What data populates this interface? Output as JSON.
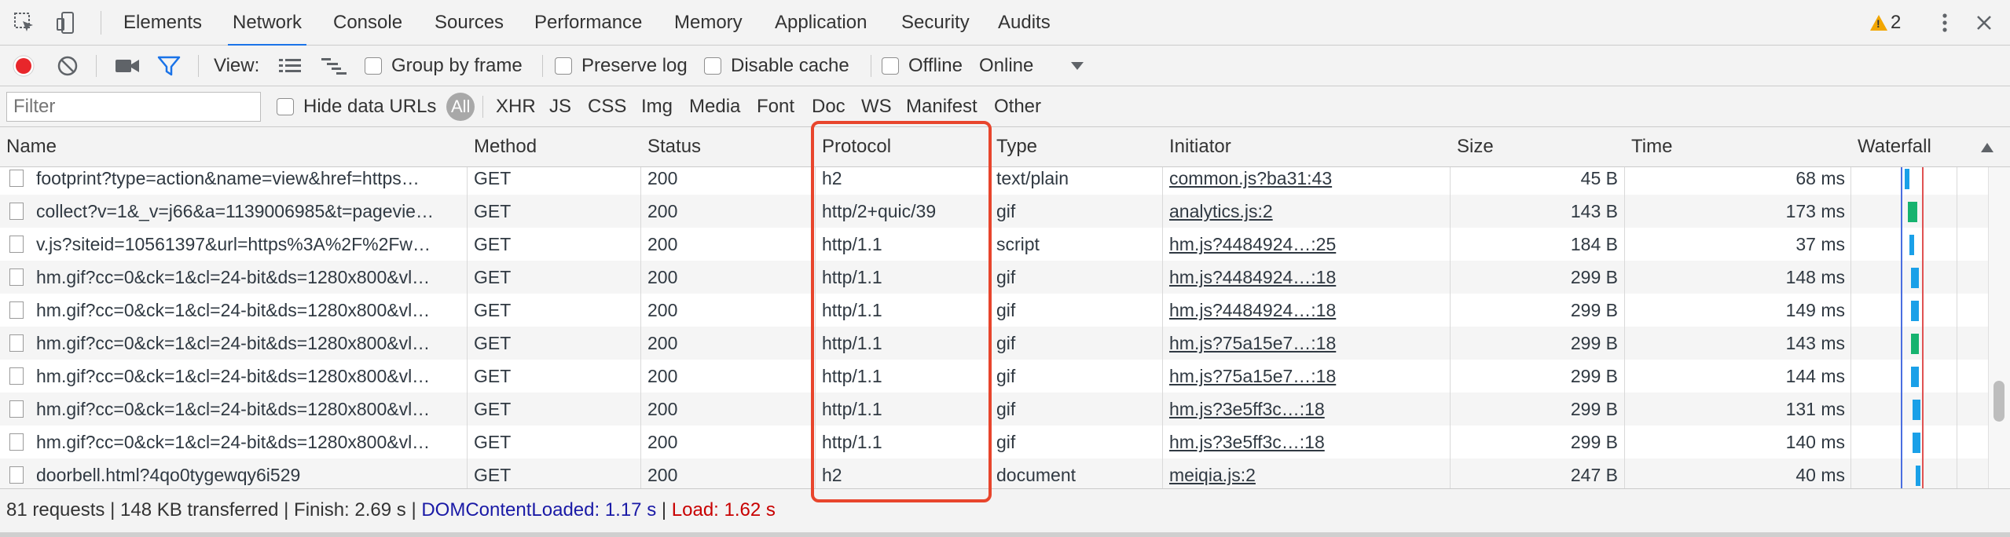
{
  "tabs": [
    "Elements",
    "Network",
    "Console",
    "Sources",
    "Performance",
    "Memory",
    "Application",
    "Security",
    "Audits"
  ],
  "active_tab": "Network",
  "warning_count": "2",
  "toolbar": {
    "view_label": "View:",
    "group_by_frame": "Group by frame",
    "preserve_log": "Preserve log",
    "disable_cache": "Disable cache",
    "offline": "Offline",
    "throttle": "Online"
  },
  "filter": {
    "placeholder": "Filter",
    "hide_data_urls": "Hide data URLs",
    "types": [
      "All",
      "XHR",
      "JS",
      "CSS",
      "Img",
      "Media",
      "Font",
      "Doc",
      "WS",
      "Manifest",
      "Other"
    ]
  },
  "columns": [
    "Name",
    "Method",
    "Status",
    "Protocol",
    "Type",
    "Initiator",
    "Size",
    "Time",
    "Waterfall"
  ],
  "rows": [
    {
      "name": "footprint?type=action&name=view&href=https…",
      "method": "GET",
      "status": "200",
      "protocol": "h2",
      "type": "text/plain",
      "initiator": "common.js?ba31:43",
      "size": "45 B",
      "time": "68 ms"
    },
    {
      "name": "collect?v=1&_v=j66&a=1139006985&t=pagevie…",
      "method": "GET",
      "status": "200",
      "protocol": "http/2+quic/39",
      "type": "gif",
      "initiator": "analytics.js:2",
      "size": "143 B",
      "time": "173 ms"
    },
    {
      "name": "v.js?siteid=10561397&url=https%3A%2F%2Fw…",
      "method": "GET",
      "status": "200",
      "protocol": "http/1.1",
      "type": "script",
      "initiator": "hm.js?4484924…:25",
      "size": "184 B",
      "time": "37 ms"
    },
    {
      "name": "hm.gif?cc=0&ck=1&cl=24-bit&ds=1280x800&vl…",
      "method": "GET",
      "status": "200",
      "protocol": "http/1.1",
      "type": "gif",
      "initiator": "hm.js?4484924…:18",
      "size": "299 B",
      "time": "148 ms"
    },
    {
      "name": "hm.gif?cc=0&ck=1&cl=24-bit&ds=1280x800&vl…",
      "method": "GET",
      "status": "200",
      "protocol": "http/1.1",
      "type": "gif",
      "initiator": "hm.js?4484924…:18",
      "size": "299 B",
      "time": "149 ms"
    },
    {
      "name": "hm.gif?cc=0&ck=1&cl=24-bit&ds=1280x800&vl…",
      "method": "GET",
      "status": "200",
      "protocol": "http/1.1",
      "type": "gif",
      "initiator": "hm.js?75a15e7…:18",
      "size": "299 B",
      "time": "143 ms"
    },
    {
      "name": "hm.gif?cc=0&ck=1&cl=24-bit&ds=1280x800&vl…",
      "method": "GET",
      "status": "200",
      "protocol": "http/1.1",
      "type": "gif",
      "initiator": "hm.js?75a15e7…:18",
      "size": "299 B",
      "time": "144 ms"
    },
    {
      "name": "hm.gif?cc=0&ck=1&cl=24-bit&ds=1280x800&vl…",
      "method": "GET",
      "status": "200",
      "protocol": "http/1.1",
      "type": "gif",
      "initiator": "hm.js?3e5ff3c…:18",
      "size": "299 B",
      "time": "131 ms"
    },
    {
      "name": "hm.gif?cc=0&ck=1&cl=24-bit&ds=1280x800&vl…",
      "method": "GET",
      "status": "200",
      "protocol": "http/1.1",
      "type": "gif",
      "initiator": "hm.js?3e5ff3c…:18",
      "size": "299 B",
      "time": "140 ms"
    },
    {
      "name": "doorbell.html?4qo0tygewqy6i529",
      "method": "GET",
      "status": "200",
      "protocol": "h2",
      "type": "document",
      "initiator": "meiqia.js:2",
      "size": "247 B",
      "time": "40 ms"
    }
  ],
  "status": {
    "requests": "81 requests",
    "transferred": "148 KB transferred",
    "finish": "Finish: 2.69 s",
    "dcl": "DOMContentLoaded: 1.17 s",
    "load": "Load: 1.62 s",
    "sep": "|"
  },
  "colors": {
    "accent": "#1a73e8",
    "record": "#e8262b",
    "highlight": "#e8452c",
    "dcl_line": "#1a1aa6",
    "load_line": "#c80000"
  }
}
